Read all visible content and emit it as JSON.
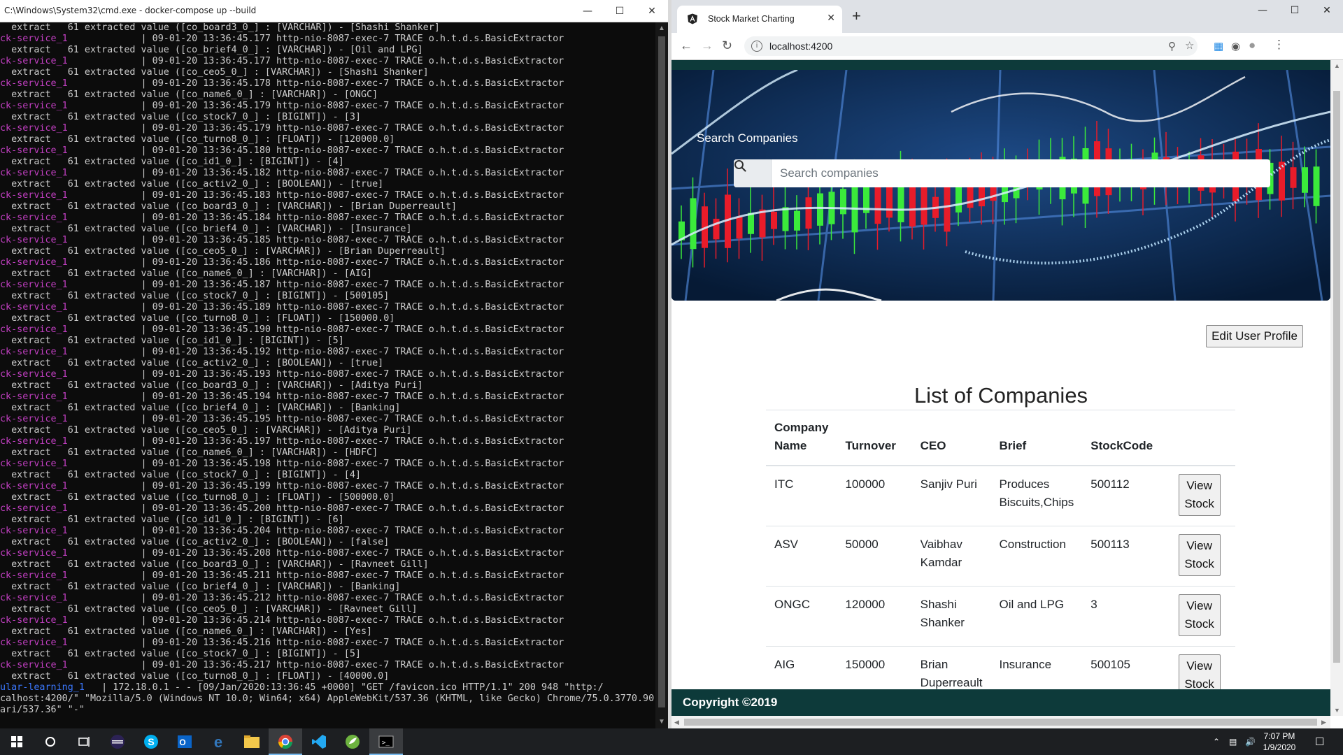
{
  "cmd": {
    "title": "C:\\Windows\\System32\\cmd.exe - docker-compose  up --build",
    "lines": [
      {
        "svc": "",
        "text": "  extract   61 extracted value ([co_board3_0_] : [VARCHAR]) - [Shashi Shanker]"
      },
      {
        "svc": "ck-service_1",
        "text": "             | 09-01-20 13:36:45.177 http-nio-8087-exec-7 TRACE o.h.t.d.s.BasicExtractor"
      },
      {
        "svc": "",
        "text": "  extract   61 extracted value ([co_brief4_0_] : [VARCHAR]) - [Oil and LPG]"
      },
      {
        "svc": "ck-service_1",
        "text": "             | 09-01-20 13:36:45.177 http-nio-8087-exec-7 TRACE o.h.t.d.s.BasicExtractor"
      },
      {
        "svc": "",
        "text": "  extract   61 extracted value ([co_ceo5_0_] : [VARCHAR]) - [Shashi Shanker]"
      },
      {
        "svc": "ck-service_1",
        "text": "             | 09-01-20 13:36:45.178 http-nio-8087-exec-7 TRACE o.h.t.d.s.BasicExtractor"
      },
      {
        "svc": "",
        "text": "  extract   61 extracted value ([co_name6_0_] : [VARCHAR]) - [ONGC]"
      },
      {
        "svc": "ck-service_1",
        "text": "             | 09-01-20 13:36:45.179 http-nio-8087-exec-7 TRACE o.h.t.d.s.BasicExtractor"
      },
      {
        "svc": "",
        "text": "  extract   61 extracted value ([co_stock7_0_] : [BIGINT]) - [3]"
      },
      {
        "svc": "ck-service_1",
        "text": "             | 09-01-20 13:36:45.179 http-nio-8087-exec-7 TRACE o.h.t.d.s.BasicExtractor"
      },
      {
        "svc": "",
        "text": "  extract   61 extracted value ([co_turno8_0_] : [FLOAT]) - [120000.0]"
      },
      {
        "svc": "ck-service_1",
        "text": "             | 09-01-20 13:36:45.180 http-nio-8087-exec-7 TRACE o.h.t.d.s.BasicExtractor"
      },
      {
        "svc": "",
        "text": "  extract   61 extracted value ([co_id1_0_] : [BIGINT]) - [4]"
      },
      {
        "svc": "ck-service_1",
        "text": "             | 09-01-20 13:36:45.182 http-nio-8087-exec-7 TRACE o.h.t.d.s.BasicExtractor"
      },
      {
        "svc": "",
        "text": "  extract   61 extracted value ([co_activ2_0_] : [BOOLEAN]) - [true]"
      },
      {
        "svc": "ck-service_1",
        "text": "             | 09-01-20 13:36:45.183 http-nio-8087-exec-7 TRACE o.h.t.d.s.BasicExtractor"
      },
      {
        "svc": "",
        "text": "  extract   61 extracted value ([co_board3_0_] : [VARCHAR]) - [Brian Duperreault]"
      },
      {
        "svc": "ck-service_1",
        "text": "             | 09-01-20 13:36:45.184 http-nio-8087-exec-7 TRACE o.h.t.d.s.BasicExtractor"
      },
      {
        "svc": "",
        "text": "  extract   61 extracted value ([co_brief4_0_] : [VARCHAR]) - [Insurance]"
      },
      {
        "svc": "ck-service_1",
        "text": "             | 09-01-20 13:36:45.185 http-nio-8087-exec-7 TRACE o.h.t.d.s.BasicExtractor"
      },
      {
        "svc": "",
        "text": "  extract   61 extracted value ([co_ceo5_0_] : [VARCHAR]) - [Brian Duperreault]"
      },
      {
        "svc": "ck-service_1",
        "text": "             | 09-01-20 13:36:45.186 http-nio-8087-exec-7 TRACE o.h.t.d.s.BasicExtractor"
      },
      {
        "svc": "",
        "text": "  extract   61 extracted value ([co_name6_0_] : [VARCHAR]) - [AIG]"
      },
      {
        "svc": "ck-service_1",
        "text": "             | 09-01-20 13:36:45.187 http-nio-8087-exec-7 TRACE o.h.t.d.s.BasicExtractor"
      },
      {
        "svc": "",
        "text": "  extract   61 extracted value ([co_stock7_0_] : [BIGINT]) - [500105]"
      },
      {
        "svc": "ck-service_1",
        "text": "             | 09-01-20 13:36:45.189 http-nio-8087-exec-7 TRACE o.h.t.d.s.BasicExtractor"
      },
      {
        "svc": "",
        "text": "  extract   61 extracted value ([co_turno8_0_] : [FLOAT]) - [150000.0]"
      },
      {
        "svc": "ck-service_1",
        "text": "             | 09-01-20 13:36:45.190 http-nio-8087-exec-7 TRACE o.h.t.d.s.BasicExtractor"
      },
      {
        "svc": "",
        "text": "  extract   61 extracted value ([co_id1_0_] : [BIGINT]) - [5]"
      },
      {
        "svc": "ck-service_1",
        "text": "             | 09-01-20 13:36:45.192 http-nio-8087-exec-7 TRACE o.h.t.d.s.BasicExtractor"
      },
      {
        "svc": "",
        "text": "  extract   61 extracted value ([co_activ2_0_] : [BOOLEAN]) - [true]"
      },
      {
        "svc": "ck-service_1",
        "text": "             | 09-01-20 13:36:45.193 http-nio-8087-exec-7 TRACE o.h.t.d.s.BasicExtractor"
      },
      {
        "svc": "",
        "text": "  extract   61 extracted value ([co_board3_0_] : [VARCHAR]) - [Aditya Puri]"
      },
      {
        "svc": "ck-service_1",
        "text": "             | 09-01-20 13:36:45.194 http-nio-8087-exec-7 TRACE o.h.t.d.s.BasicExtractor"
      },
      {
        "svc": "",
        "text": "  extract   61 extracted value ([co_brief4_0_] : [VARCHAR]) - [Banking]"
      },
      {
        "svc": "ck-service_1",
        "text": "             | 09-01-20 13:36:45.195 http-nio-8087-exec-7 TRACE o.h.t.d.s.BasicExtractor"
      },
      {
        "svc": "",
        "text": "  extract   61 extracted value ([co_ceo5_0_] : [VARCHAR]) - [Aditya Puri]"
      },
      {
        "svc": "ck-service_1",
        "text": "             | 09-01-20 13:36:45.197 http-nio-8087-exec-7 TRACE o.h.t.d.s.BasicExtractor"
      },
      {
        "svc": "",
        "text": "  extract   61 extracted value ([co_name6_0_] : [VARCHAR]) - [HDFC]"
      },
      {
        "svc": "ck-service_1",
        "text": "             | 09-01-20 13:36:45.198 http-nio-8087-exec-7 TRACE o.h.t.d.s.BasicExtractor"
      },
      {
        "svc": "",
        "text": "  extract   61 extracted value ([co_stock7_0_] : [BIGINT]) - [4]"
      },
      {
        "svc": "ck-service_1",
        "text": "             | 09-01-20 13:36:45.199 http-nio-8087-exec-7 TRACE o.h.t.d.s.BasicExtractor"
      },
      {
        "svc": "",
        "text": "  extract   61 extracted value ([co_turno8_0_] : [FLOAT]) - [500000.0]"
      },
      {
        "svc": "ck-service_1",
        "text": "             | 09-01-20 13:36:45.200 http-nio-8087-exec-7 TRACE o.h.t.d.s.BasicExtractor"
      },
      {
        "svc": "",
        "text": "  extract   61 extracted value ([co_id1_0_] : [BIGINT]) - [6]"
      },
      {
        "svc": "ck-service_1",
        "text": "             | 09-01-20 13:36:45.204 http-nio-8087-exec-7 TRACE o.h.t.d.s.BasicExtractor"
      },
      {
        "svc": "",
        "text": "  extract   61 extracted value ([co_activ2_0_] : [BOOLEAN]) - [false]"
      },
      {
        "svc": "ck-service_1",
        "text": "             | 09-01-20 13:36:45.208 http-nio-8087-exec-7 TRACE o.h.t.d.s.BasicExtractor"
      },
      {
        "svc": "",
        "text": "  extract   61 extracted value ([co_board3_0_] : [VARCHAR]) - [Ravneet Gill]"
      },
      {
        "svc": "ck-service_1",
        "text": "             | 09-01-20 13:36:45.211 http-nio-8087-exec-7 TRACE o.h.t.d.s.BasicExtractor"
      },
      {
        "svc": "",
        "text": "  extract   61 extracted value ([co_brief4_0_] : [VARCHAR]) - [Banking]"
      },
      {
        "svc": "ck-service_1",
        "text": "             | 09-01-20 13:36:45.212 http-nio-8087-exec-7 TRACE o.h.t.d.s.BasicExtractor"
      },
      {
        "svc": "",
        "text": "  extract   61 extracted value ([co_ceo5_0_] : [VARCHAR]) - [Ravneet Gill]"
      },
      {
        "svc": "ck-service_1",
        "text": "             | 09-01-20 13:36:45.214 http-nio-8087-exec-7 TRACE o.h.t.d.s.BasicExtractor"
      },
      {
        "svc": "",
        "text": "  extract   61 extracted value ([co_name6_0_] : [VARCHAR]) - [Yes]"
      },
      {
        "svc": "ck-service_1",
        "text": "             | 09-01-20 13:36:45.216 http-nio-8087-exec-7 TRACE o.h.t.d.s.BasicExtractor"
      },
      {
        "svc": "",
        "text": "  extract   61 extracted value ([co_stock7_0_] : [BIGINT]) - [5]"
      },
      {
        "svc": "ck-service_1",
        "text": "             | 09-01-20 13:36:45.217 http-nio-8087-exec-7 TRACE o.h.t.d.s.BasicExtractor"
      },
      {
        "svc": "",
        "text": "  extract   61 extracted value ([co_turno8_0_] : [FLOAT]) - [40000.0]"
      }
    ],
    "tail_lines": [
      {
        "svc": "ular-learning_1",
        "text": "   | 172.18.0.1 - - [09/Jan/2020:13:36:45 +0000] \"GET /favicon.ico HTTP/1.1\" 200 948 \"http:/"
      },
      {
        "svc": "",
        "text": "calhost:4200/\" \"Mozilla/5.0 (Windows NT 10.0; Win64; x64) AppleWebKit/537.36 (KHTML, like Gecko) Chrome/75.0.3770.90"
      },
      {
        "svc": "",
        "text": "ari/537.36\" \"-\""
      }
    ]
  },
  "browser": {
    "tab_title": "Stock Market Charting",
    "url": "localhost:4200"
  },
  "page": {
    "search_label": "Search Companies",
    "search_placeholder": "Search companies",
    "edit_profile_label": "Edit User Profile",
    "list_title": "List of Companies",
    "table": {
      "headers": [
        "Company Name",
        "Turnover",
        "CEO",
        "Brief",
        "StockCode"
      ],
      "rows": [
        {
          "name": "ITC",
          "turnover": "100000",
          "ceo": "Sanjiv Puri",
          "brief": "Produces Biscuits,Chips",
          "stock": "500112",
          "action": "View Stock"
        },
        {
          "name": "ASV",
          "turnover": "50000",
          "ceo": "Vaibhav Kamdar",
          "brief": "Construction",
          "stock": "500113",
          "action": "View Stock"
        },
        {
          "name": "ONGC",
          "turnover": "120000",
          "ceo": "Shashi Shanker",
          "brief": "Oil and LPG",
          "stock": "3",
          "action": "View Stock"
        },
        {
          "name": "AIG",
          "turnover": "150000",
          "ceo": "Brian Duperreault",
          "brief": "Insurance",
          "stock": "500105",
          "action": "View Stock"
        }
      ]
    },
    "footer": "Copyright ©2019"
  },
  "taskbar": {
    "time": "7:07 PM",
    "date": "1/9/2020"
  }
}
